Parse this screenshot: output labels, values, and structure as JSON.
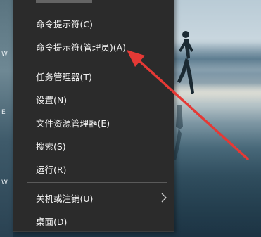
{
  "menu": {
    "items": [
      {
        "label": "命令提示符(C)"
      },
      {
        "label": "命令提示符(管理员)(A)"
      },
      {
        "label": "任务管理器(T)"
      },
      {
        "label": "设置(N)"
      },
      {
        "label": "文件资源管理器(E)"
      },
      {
        "label": "搜索(S)"
      },
      {
        "label": "运行(R)"
      },
      {
        "label": "关机或注销(U)",
        "has_submenu": true
      },
      {
        "label": "桌面(D)"
      }
    ],
    "submenu_icon": "chevron-right-icon"
  },
  "desktop": {
    "icon_labels": [
      "W",
      "E",
      "W"
    ]
  },
  "annotation": {
    "color": "#e53935",
    "points_to": "命令提示符(管理员)(A)"
  }
}
